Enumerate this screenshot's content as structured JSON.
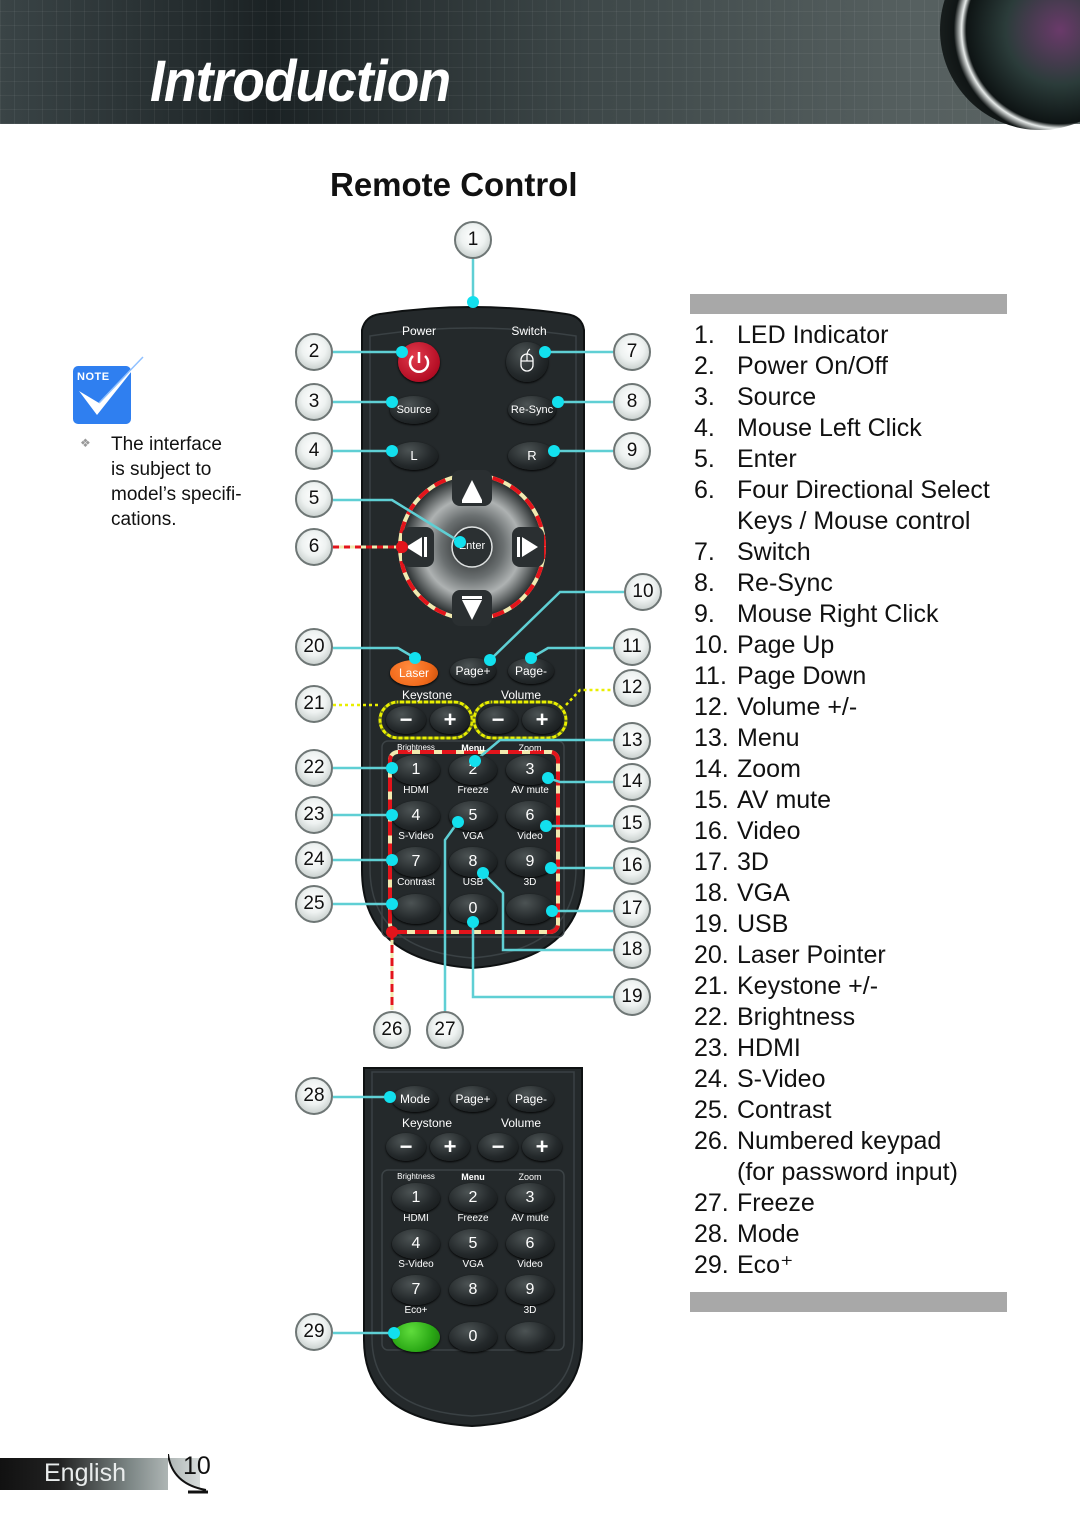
{
  "header": {
    "section_title": "Introduction"
  },
  "page": {
    "title": "Remote Control",
    "language": "English",
    "page_number": "10"
  },
  "note": {
    "badge_label": "Note",
    "bullet_icon": "four-diamond-bullet",
    "text_lines": [
      "The interface",
      "is subject to",
      "model’s specifi-",
      "cations."
    ]
  },
  "remote_top": {
    "labels": {
      "power": "Power",
      "switch": "Switch",
      "source": "Source",
      "resync": "Re-Sync",
      "left_click": "L",
      "right_click": "R",
      "enter": "Enter",
      "laser": "Laser",
      "page_up": "Page+",
      "page_down": "Page-",
      "keystone": "Keystone",
      "volume": "Volume",
      "minus": "−",
      "plus": "+",
      "brightness": "Brightness",
      "menu": "Menu",
      "zoom": "Zoom",
      "hdmi": "HDMI",
      "freeze": "Freeze",
      "av_mute": "AV mute",
      "svideo": "S-Video",
      "vga": "VGA",
      "video": "Video",
      "contrast": "Contrast",
      "usb": "USB",
      "three_d": "3D"
    },
    "keys": [
      "1",
      "2",
      "3",
      "4",
      "5",
      "6",
      "7",
      "8",
      "9",
      "0"
    ],
    "colors": {
      "power": "#c8102e",
      "laser": "#f26a1b",
      "callout_line": "#5fcfd4",
      "dot": "#12e0ee"
    }
  },
  "remote_bottom": {
    "labels": {
      "mode": "Mode",
      "page_up": "Page+",
      "page_down": "Page-",
      "keystone": "Keystone",
      "volume": "Volume",
      "minus": "−",
      "plus": "+",
      "brightness": "Brightness",
      "menu": "Menu",
      "zoom": "Zoom",
      "hdmi": "HDMI",
      "freeze": "Freeze",
      "av_mute": "AV mute",
      "svideo": "S-Video",
      "vga": "VGA",
      "video": "Video",
      "eco": "Eco+",
      "three_d": "3D"
    },
    "keys": [
      "1",
      "2",
      "3",
      "4",
      "5",
      "6",
      "7",
      "8",
      "9",
      "0"
    ],
    "colors": {
      "eco": "#2aa815"
    }
  },
  "callouts": [
    "1",
    "2",
    "3",
    "4",
    "5",
    "6",
    "7",
    "8",
    "9",
    "10",
    "11",
    "12",
    "13",
    "14",
    "15",
    "16",
    "17",
    "18",
    "19",
    "20",
    "21",
    "22",
    "23",
    "24",
    "25",
    "26",
    "27",
    "28",
    "29"
  ],
  "legend": [
    {
      "num": "1.",
      "text": "LED Indicator"
    },
    {
      "num": "2.",
      "text": "Power On/Off"
    },
    {
      "num": "3.",
      "text": "Source"
    },
    {
      "num": "4.",
      "text": "Mouse Left Click"
    },
    {
      "num": "5.",
      "text": "Enter"
    },
    {
      "num": "6.",
      "text": "Four Directional Select"
    },
    {
      "num": "",
      "text": "Keys / Mouse control"
    },
    {
      "num": "7.",
      "text": "Switch"
    },
    {
      "num": "8.",
      "text": "Re-Sync"
    },
    {
      "num": "9.",
      "text": "Mouse Right Click"
    },
    {
      "num": "10.",
      "text": "Page Up"
    },
    {
      "num": "11.",
      "text": "Page Down"
    },
    {
      "num": "12.",
      "text": "Volume +/-"
    },
    {
      "num": "13.",
      "text": "Menu"
    },
    {
      "num": "14.",
      "text": "Zoom"
    },
    {
      "num": "15.",
      "text": "AV mute"
    },
    {
      "num": "16.",
      "text": "Video"
    },
    {
      "num": "17.",
      "text": "3D"
    },
    {
      "num": "18.",
      "text": "VGA"
    },
    {
      "num": "19.",
      "text": "USB"
    },
    {
      "num": "20.",
      "text": "Laser Pointer"
    },
    {
      "num": "21.",
      "text": "Keystone +/-"
    },
    {
      "num": "22.",
      "text": "Brightness"
    },
    {
      "num": "23.",
      "text": "HDMI"
    },
    {
      "num": "24.",
      "text": "S-Video"
    },
    {
      "num": "25.",
      "text": "Contrast"
    },
    {
      "num": "26.",
      "text": "Numbered keypad"
    },
    {
      "num": "",
      "text": "(for password input)"
    },
    {
      "num": "27.",
      "text": "Freeze"
    },
    {
      "num": "28.",
      "text": "Mode"
    },
    {
      "num": "29.",
      "text": "Eco⁺"
    }
  ]
}
